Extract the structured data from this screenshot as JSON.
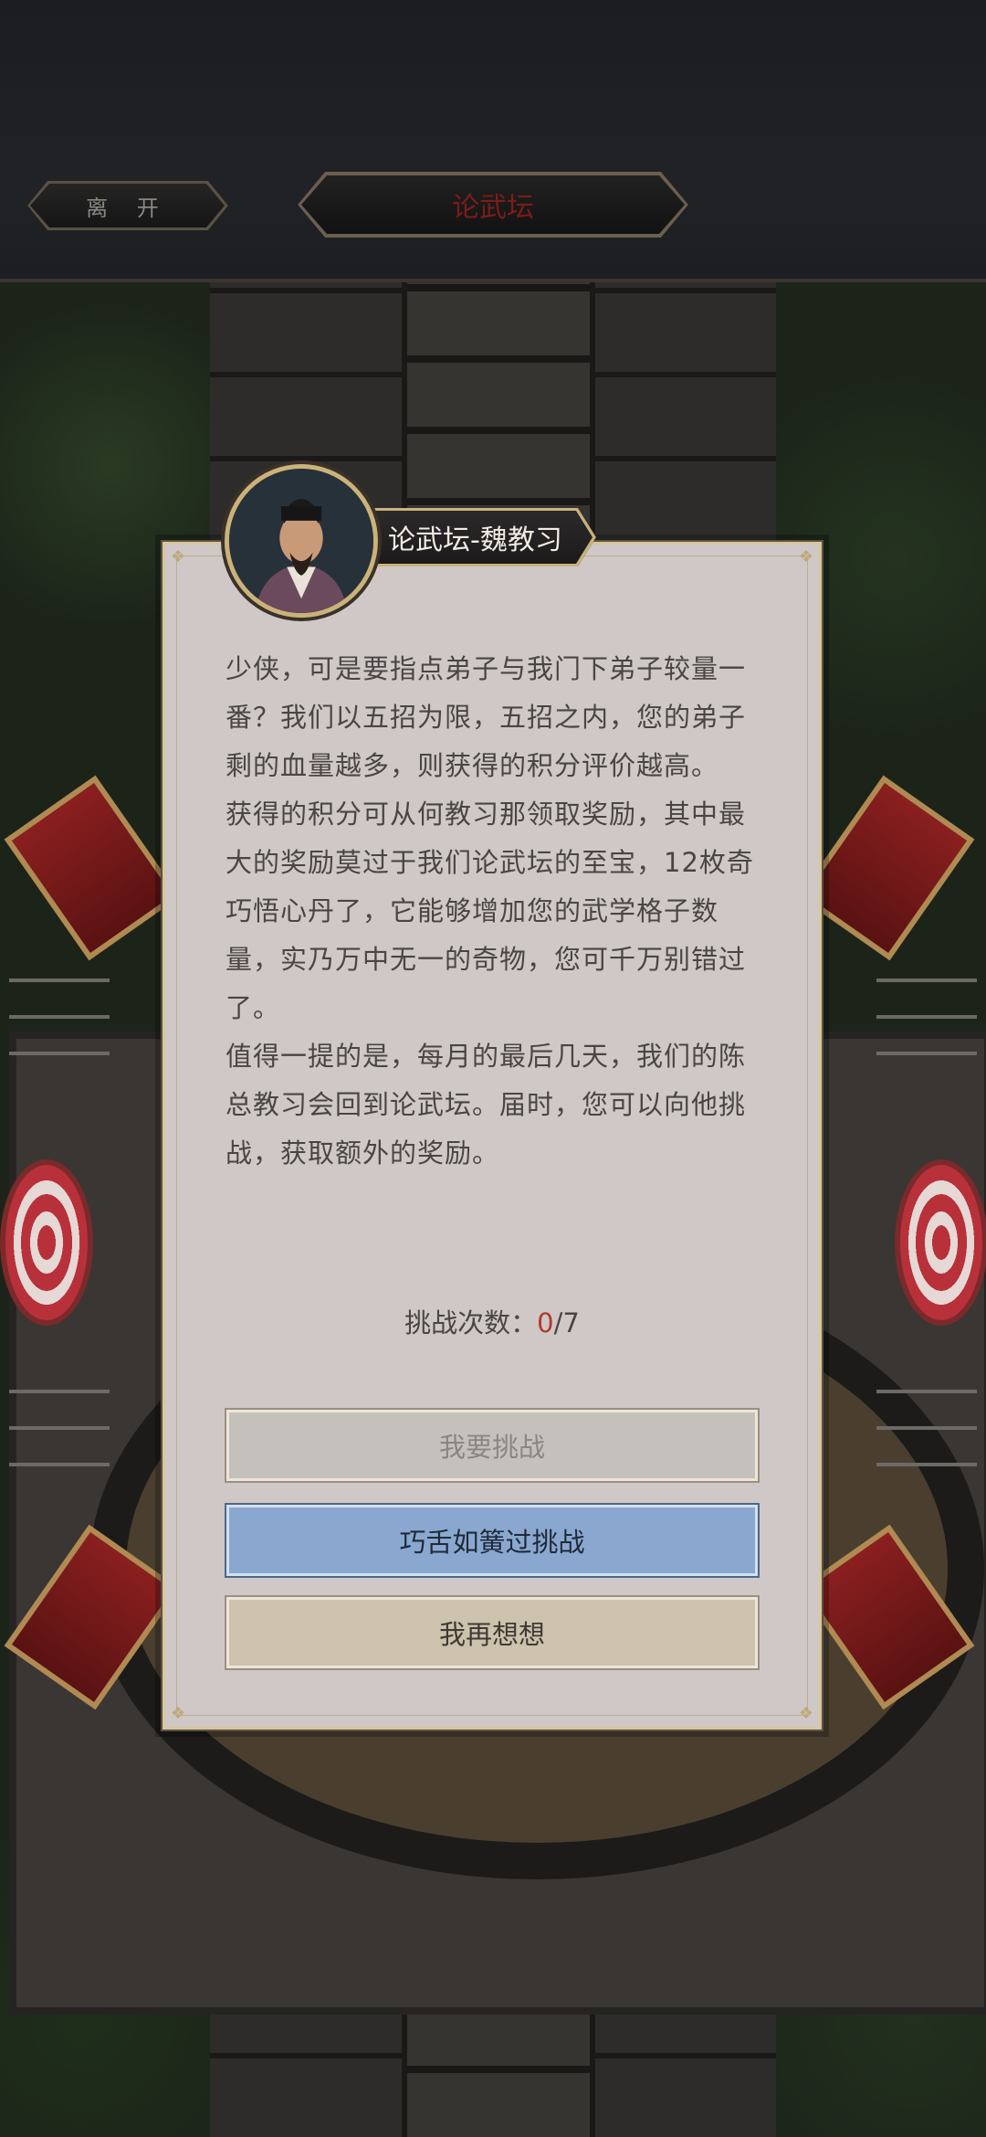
{
  "header": {
    "back_label": "离 开",
    "title": "论武坛"
  },
  "dialog": {
    "npc_name": "论武坛-魏教习",
    "paragraphs": [
      "少侠，可是要指点弟子与我门下弟子较量一番？我们以五招为限，五招之内，您的弟子剩的血量越多，则获得的积分评价越高。",
      "获得的积分可从何教习那领取奖励，其中最大的奖励莫过于我们论武坛的至宝，12枚奇巧悟心丹了，它能够增加您的武学格子数量，实乃万中无一的奇物，您可千万别错过了。",
      "值得一提的是，每月的最后几天，我们的陈总教习会回到论武坛。届时，您可以向他挑战，获取额外的奖励。"
    ],
    "attempts_label": "挑战次数：",
    "attempts_used": "0",
    "attempts_total": "/7",
    "buttons": {
      "challenge": "我要挑战",
      "skip": "巧舌如簧过挑战",
      "think": "我再想想"
    }
  },
  "colors": {
    "accent_red": "#b03a2e",
    "skip_button": "#8aa8cf",
    "think_button": "#cdc2ad",
    "disabled_button": "#c4c1bd"
  }
}
